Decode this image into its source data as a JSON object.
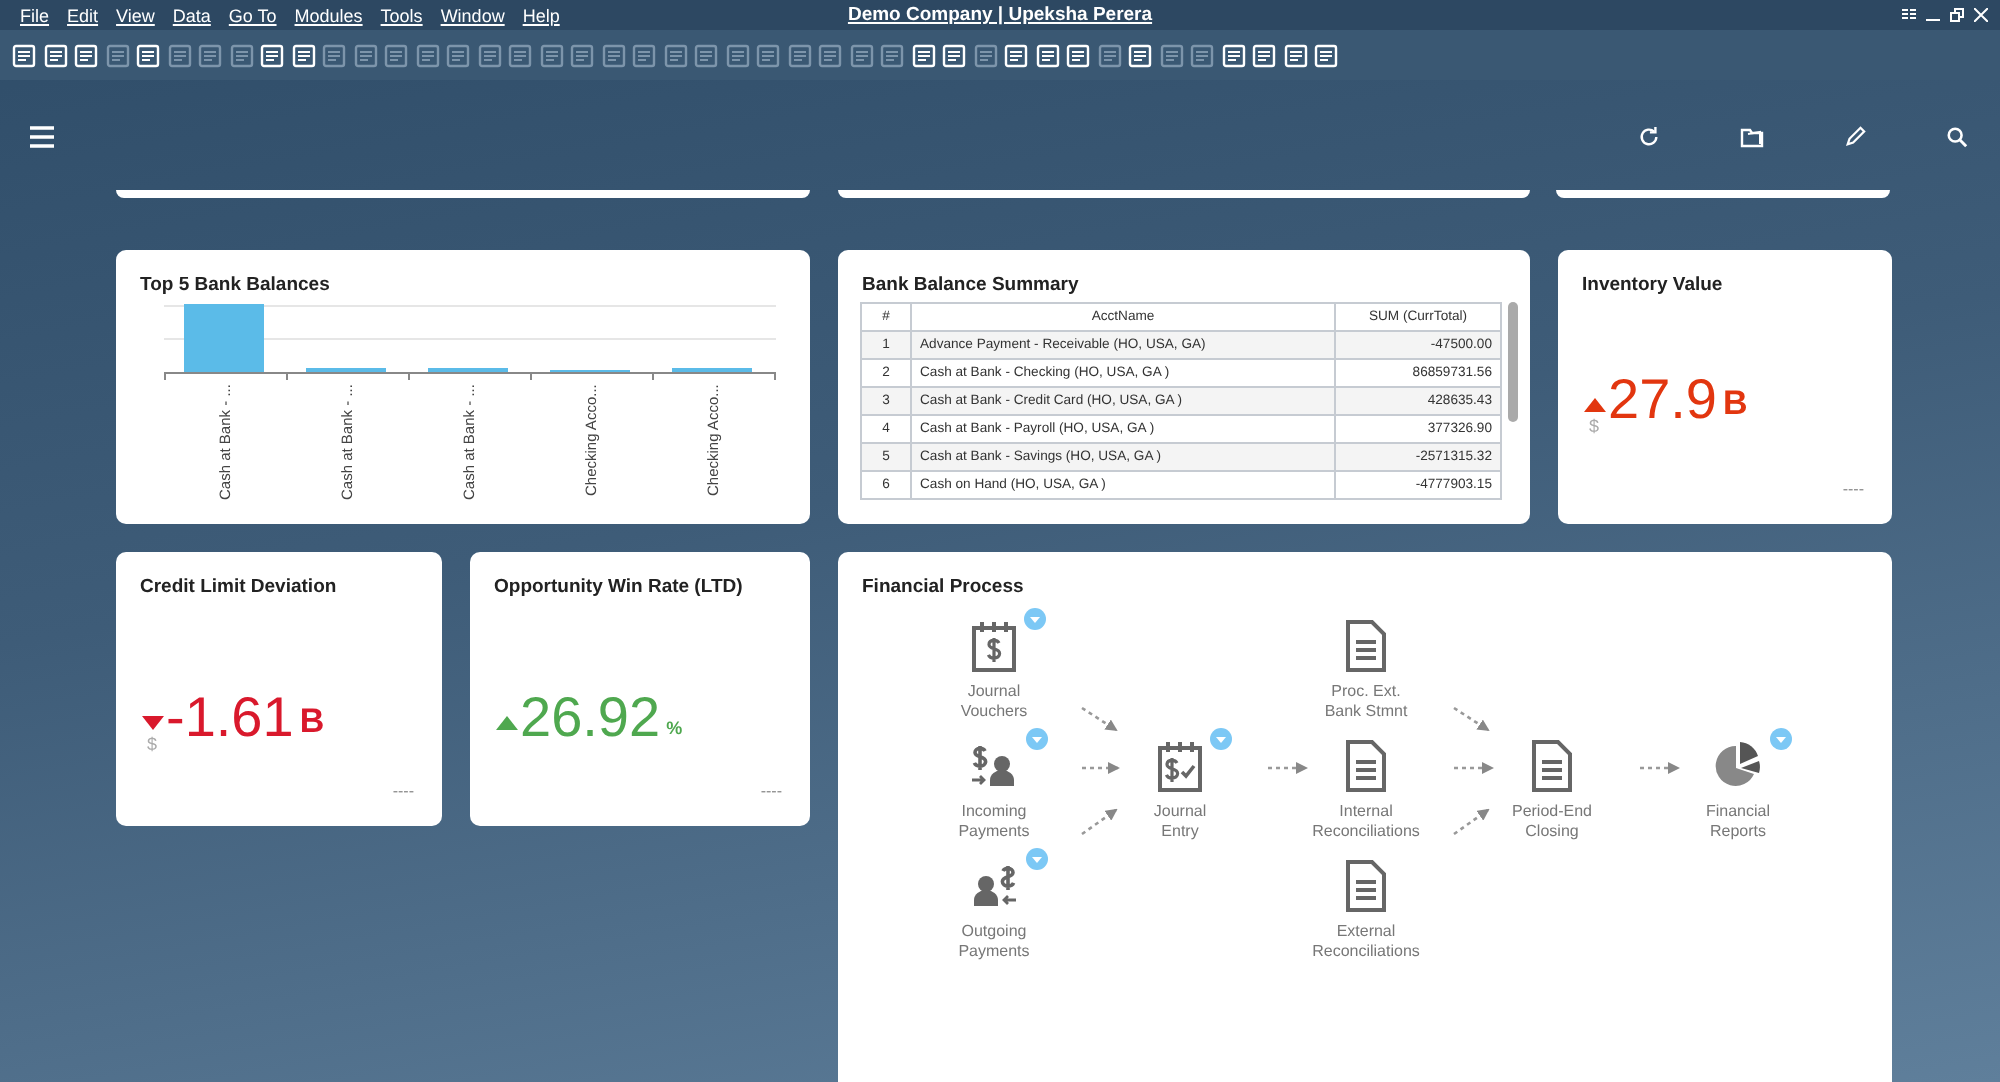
{
  "menu": [
    "File",
    "Edit",
    "View",
    "Data",
    "Go To",
    "Modules",
    "Tools",
    "Window",
    "Help"
  ],
  "title": "Demo Company | Upeksha Perera",
  "toolbar": [
    {
      "disabled": false
    },
    {
      "disabled": false
    },
    {
      "disabled": false
    },
    {
      "disabled": true
    },
    {
      "disabled": false
    },
    {
      "disabled": true
    },
    {
      "disabled": true
    },
    {
      "disabled": true
    },
    {
      "disabled": false
    },
    {
      "disabled": false
    },
    {
      "disabled": true
    },
    {
      "disabled": true
    },
    {
      "disabled": true
    },
    {
      "disabled": true
    },
    {
      "disabled": true
    },
    {
      "disabled": true
    },
    {
      "disabled": true
    },
    {
      "disabled": true
    },
    {
      "disabled": true
    },
    {
      "disabled": true
    },
    {
      "disabled": true
    },
    {
      "disabled": true
    },
    {
      "disabled": true
    },
    {
      "disabled": true
    },
    {
      "disabled": true
    },
    {
      "disabled": true
    },
    {
      "disabled": true
    },
    {
      "disabled": true
    },
    {
      "disabled": true
    },
    {
      "disabled": false
    },
    {
      "disabled": false
    },
    {
      "disabled": true
    },
    {
      "disabled": false
    },
    {
      "disabled": false
    },
    {
      "disabled": false
    },
    {
      "disabled": true
    },
    {
      "disabled": false
    },
    {
      "disabled": true
    },
    {
      "disabled": true
    },
    {
      "disabled": false
    },
    {
      "disabled": false
    },
    {
      "disabled": false
    },
    {
      "disabled": false
    }
  ],
  "bank_chart": {
    "title": "Top 5 Bank Balances",
    "labels": [
      "Cash at Bank - ...",
      "Cash at Bank - ...",
      "Cash at Bank - ...",
      "Checking Acco...",
      "Checking Acco..."
    ]
  },
  "bank_table": {
    "title": "Bank Balance Summary",
    "columns": [
      "#",
      "AcctName",
      "SUM (CurrTotal)"
    ],
    "rows": [
      [
        "1",
        "Advance Payment - Receivable (HO, USA, GA)",
        "-47500.00"
      ],
      [
        "2",
        "Cash at Bank - Checking (HO, USA, GA )",
        "86859731.56"
      ],
      [
        "3",
        "Cash at Bank - Credit Card (HO, USA, GA )",
        "428635.43"
      ],
      [
        "4",
        "Cash at Bank - Payroll (HO, USA, GA )",
        "377326.90"
      ],
      [
        "5",
        "Cash at Bank - Savings (HO, USA, GA )",
        "-2571315.32"
      ],
      [
        "6",
        "Cash on Hand (HO, USA, GA )",
        "-4777903.15"
      ]
    ]
  },
  "inventory": {
    "title": "Inventory Value",
    "rising": true,
    "color": "#e2360f",
    "value": "27.9",
    "unit": "B",
    "currency": "$",
    "footer": "----"
  },
  "kpis": [
    {
      "title": "Credit Limit Deviation",
      "rising": false,
      "color": "#d9192c",
      "value": "-1.61",
      "unit": "B",
      "currency": "$",
      "footer": "----"
    },
    {
      "title": "Opportunity Win Rate (LTD)",
      "rising": true,
      "color": "#4fa84f",
      "value": "26.92",
      "unit": "%",
      "footer": "----"
    }
  ],
  "process": {
    "title": "Financial Process",
    "columns": [
      {
        "nodes": [
          {
            "lines": [
              "Journal",
              "Vouchers"
            ],
            "kind": "voucher",
            "menu": true
          },
          {
            "lines": [
              "Incoming",
              "Payments"
            ],
            "kind": "incoming",
            "menu": true
          },
          {
            "lines": [
              "Outgoing",
              "Payments"
            ],
            "kind": "outgoing",
            "menu": true
          }
        ]
      },
      {
        "nodes": [
          {
            "lines": [
              "Journal",
              "Entry"
            ],
            "kind": "entry",
            "menu": true
          }
        ]
      },
      {
        "nodes": [
          {
            "lines": [
              "Proc. Ext.",
              "Bank Stmnt"
            ],
            "kind": "document",
            "menu": false
          },
          {
            "lines": [
              "Internal",
              "Reconciliations"
            ],
            "kind": "document",
            "menu": false
          },
          {
            "lines": [
              "External",
              "Reconciliations"
            ],
            "kind": "document",
            "menu": false
          }
        ]
      },
      {
        "nodes": [
          {
            "lines": [
              "Period-End",
              "Closing"
            ],
            "kind": "document",
            "menu": false
          }
        ]
      },
      {
        "nodes": [
          {
            "lines": [
              "Financial",
              "Reports"
            ],
            "kind": "report",
            "menu": true
          }
        ]
      }
    ]
  }
}
